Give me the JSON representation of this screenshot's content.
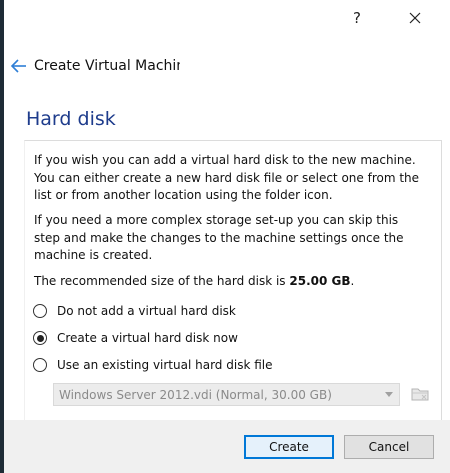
{
  "window": {
    "title_help": "?",
    "title_close": "✕"
  },
  "header": {
    "title": "Create Virtual Machine"
  },
  "page": {
    "title": "Hard disk",
    "para1": "If you wish you can add a virtual hard disk to the new machine. You can either create a new hard disk file or select one from the list or from another location using the folder icon.",
    "para2": "If you need a more complex storage set-up you can skip this step and make the changes to the machine settings once the machine is created.",
    "para3_prefix": "The recommended size of the hard disk is ",
    "para3_size": "25.00 GB",
    "para3_suffix": "."
  },
  "options": [
    {
      "label": "Do not add a virtual hard disk",
      "checked": false
    },
    {
      "label": "Create a virtual hard disk now",
      "checked": true
    },
    {
      "label": "Use an existing virtual hard disk file",
      "checked": false
    }
  ],
  "existing_disk": {
    "selected": "Windows Server 2012.vdi (Normal, 30.00 GB)",
    "enabled": false
  },
  "buttons": {
    "create": "Create",
    "cancel": "Cancel"
  },
  "colors": {
    "accent": "#0078d7",
    "title_blue": "#1e3c8c"
  }
}
